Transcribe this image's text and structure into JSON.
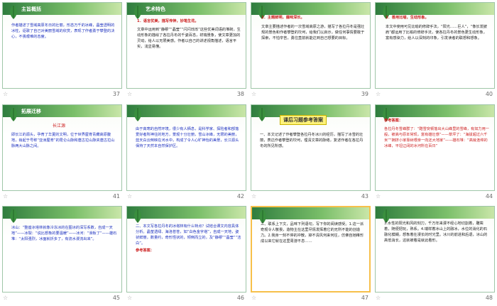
{
  "slides": [
    {
      "num": "37",
      "title": "主旨概括",
      "body": "作者描述了雪域高原冬日的壮丽，形态万千的冰峰，晶莹透明的冰柱，讴歌了自己对美丽雪域的欣赏，表现了作者勇于攀登的决心，不畏艰难的态度。"
    },
    {
      "num": "38",
      "title": "艺术特色",
      "sub": "1．语言优美，描写传神，妙笔生花。",
      "body": "文章中运用到“静穆”“晶莹”“闪闪烁烁”这些优美词语的堆砌，生动形象的描绘了各拉丹冬的千姿百态，祥瑞景象，使文章更加的灵动，给人以无限美感。作者以自己的讲述视角描述，语言平实，浅显易懂。"
    },
    {
      "num": "39",
      "title": "",
      "sub": "2．主题鲜明，蕴味深长。",
      "body": "文章主要描述作者的一次雪域高原之游，描写了各拉丹冬是强壮规的景色和作者攀登的坎坷，给我们以启示，做任何事情要敢于探索，不怕辛苦，勇往直前就能达到自己想要的目标。"
    },
    {
      "num": "40",
      "title": "",
      "sub": "3．善用比喻，生动形象。",
      "body": "本文中使用可见比喻的修辞手法，“阳光……巨人”，“像长发披肩”都运用了比喻的修辞手法，使各拉丹冬的景色更生动形象，富有感染力，给人以深刻的印象，引发读者的联想和想象。"
    },
    {
      "num": "41",
      "title": "拓展迁移",
      "sub": "长江源",
      "body": "即长江的源头，孕育了华夏的文明，位于世界屋脊青藏高原腹地，耸起于号称“亚洲屋脊”的昆仑山脉和唐古拉山脉夹唐古拉山脉两大山脉之间。"
    },
    {
      "num": "42",
      "title": "",
      "sub": "",
      "body": "由于高寒的自然环境，很少有人栖息，是科学家、探险者和部落爱好者所神往的地方，景观十分壮丽，雪山冰峰，无限的美丽，蓝天白云倒映在河水中，构成了令人心旷神怡的美景，长江源头保持了天然本自然保护区。"
    },
    {
      "num": "43",
      "title": "课后习题参考答案",
      "sub": "",
      "body": "一、本文记述了作者攀登各拉丹冬冰川的经历，描写了冰雪的壮丽，表达作者攀登的坎坷，理清文章的脉络，复述作者在各拉丹冬的所见所感。"
    },
    {
      "num": "44",
      "title": "",
      "sub": "参考答案：",
      "body": "各拉丹冬雪峰群了：“酷雪突顿落出大山峰里的雪峰，有如力用一般，被高与原本常现，富有雄壮感”——草坪了：“海拔超过六千米”“拥挤小家靠树根亲一向还大地家”——雄石堆：“高耸连绵的冰峰，平坦辽阔的冰河所在百日”"
    },
    {
      "num": "45",
      "title": "",
      "sub": "",
      "body": "冰山：“整座冰塔林就像冷冻冰的在图冰的深写系数，自成一天地”——冰裂：“说比想象的要温暖”——冰河：“滑板了”——雄石堆：“太阳强烈，冰面就折多了，有流水漫流出来”。"
    },
    {
      "num": "46",
      "title": "",
      "sub": "参考答案：",
      "body": "二、本文写各拉丹冬的冰塔林有什么特点？试结合课文内容具体分析。晶莹透绿、海洛苍苍，如“白色金字塔”，自成一天地，姿状鲜丽，数量约，奇形怪状的，倾倒而立的，及“静穆”“晶莹”“洁白”。"
    },
    {
      "num": "47",
      "title": "",
      "sub": "",
      "body": "三、联系上下文，品味下列语句，写下你的阅读感受。1.这一派奇观令人敬畏，造物主在这里尽情发挥着它的无所不能的创造力。2.我身一刻不停的冲散，掉不清风何来何往，仿佛自她稚形成以来它就在这里周游不息……"
    },
    {
      "num": "48",
      "title": "",
      "sub": "",
      "body": "3.水性的阳光和风的刻刀，千万年来漫不经心地切割着，雕凿着，随便把玩，熟系。4.瑞祥着冰山上的融冰，水位的消化的石融化模糊，想象着在漫长的时光里。冰川的前进和后退，冰山的高低消长，这就被看是就此看形。"
    }
  ]
}
